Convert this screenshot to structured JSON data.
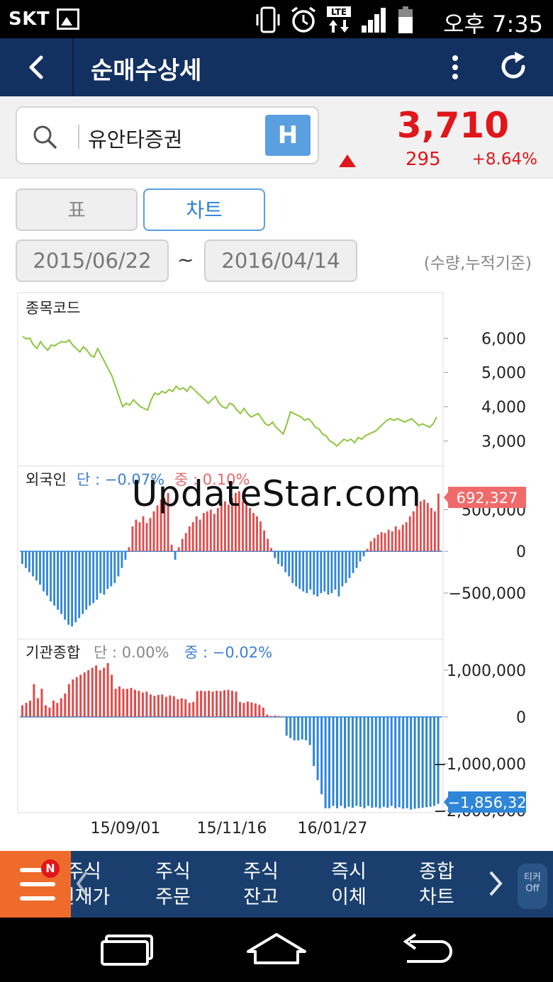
{
  "status_bar": {
    "carrier": "SKT",
    "network": "LTE",
    "time": "오후 7:35"
  },
  "header": {
    "title": "순매수상세"
  },
  "search": {
    "value": "유안타증권",
    "h_button": "H"
  },
  "quote": {
    "price": "3,710",
    "change": "295",
    "change_pct": "+8.64%",
    "direction": "up",
    "up_color": "#e0161a"
  },
  "tabs": {
    "table": "표",
    "chart": "차트",
    "active": "chart"
  },
  "date_range": {
    "from": "2015/06/22",
    "separator": "~",
    "to": "2016/04/14",
    "basis_note": "(수량,누적기준)"
  },
  "chart_data": [
    {
      "type": "line",
      "title": "종목코드",
      "x_ticks": [
        "15/09/01",
        "15/11/16",
        "16/01/27"
      ],
      "y_ticks": [
        "6,000",
        "5,000",
        "4,000",
        "3,000"
      ],
      "ylim": [
        2800,
        6400
      ],
      "color": "#8dc63f",
      "values": [
        6050,
        5980,
        6000,
        5800,
        5700,
        5900,
        5750,
        5650,
        5800,
        5780,
        5850,
        5900,
        5880,
        5950,
        5800,
        5700,
        5600,
        5750,
        5650,
        5500,
        5450,
        5700,
        5500,
        5300,
        5100,
        4900,
        4600,
        4300,
        4000,
        4100,
        4050,
        4200,
        4100,
        4000,
        3950,
        3900,
        4200,
        4400,
        4350,
        4450,
        4400,
        4500,
        4450,
        4600,
        4500,
        4550,
        4450,
        4600,
        4500,
        4400,
        4300,
        4200,
        4100,
        4200,
        4300,
        4100,
        4000,
        3950,
        4100,
        4050,
        3900,
        3800,
        3950,
        3800,
        3700,
        3750,
        3800,
        3650,
        3500,
        3450,
        3550,
        3400,
        3300,
        3200,
        3500,
        3850,
        3800,
        3750,
        3700,
        3600,
        3650,
        3550,
        3400,
        3350,
        3200,
        3150,
        3000,
        2950,
        2850,
        2950,
        3050,
        3000,
        3050,
        2950,
        3100,
        3050,
        3150,
        3200,
        3250,
        3300,
        3400,
        3500,
        3600,
        3650,
        3600,
        3650,
        3600,
        3550,
        3600,
        3650,
        3550,
        3450,
        3500,
        3450,
        3400,
        3500,
        3700
      ]
    },
    {
      "type": "bar",
      "title": "외국인",
      "annotations": [
        {
          "label": "단 : −0.07%",
          "color": "#3d7fd1"
        },
        {
          "label": "중 : 0.10%",
          "color": "#e36b6b"
        }
      ],
      "y_ticks": [
        "500,000",
        "0",
        "−500,000"
      ],
      "last_value_label": "692,327",
      "ylim": [
        -950000,
        800000
      ],
      "pos_color": "#e24a4a",
      "neg_color": "#2e86d8",
      "values": [
        -150000,
        -200000,
        -250000,
        -300000,
        -350000,
        -400000,
        -480000,
        -530000,
        -600000,
        -650000,
        -700000,
        -750000,
        -820000,
        -880000,
        -900000,
        -850000,
        -800000,
        -750000,
        -700000,
        -650000,
        -620000,
        -580000,
        -500000,
        -520000,
        -450000,
        -420000,
        -380000,
        -300000,
        -200000,
        -100000,
        50000,
        300000,
        380000,
        350000,
        420000,
        340000,
        400000,
        480000,
        550000,
        620000,
        640000,
        700000,
        80000,
        -100000,
        50000,
        150000,
        220000,
        300000,
        350000,
        420000,
        380000,
        460000,
        480000,
        500000,
        450000,
        520000,
        580000,
        600000,
        560000,
        640000,
        700000,
        720000,
        600000,
        560000,
        520000,
        460000,
        420000,
        360000,
        250000,
        150000,
        40000,
        -80000,
        -150000,
        -180000,
        -250000,
        -300000,
        -380000,
        -420000,
        -450000,
        -480000,
        -500000,
        -460000,
        -520000,
        -540000,
        -500000,
        -480000,
        -520000,
        -500000,
        -460000,
        -540000,
        -420000,
        -380000,
        -320000,
        -260000,
        -200000,
        -120000,
        -60000,
        30000,
        120000,
        160000,
        200000,
        230000,
        220000,
        260000,
        240000,
        300000,
        260000,
        320000,
        350000,
        420000,
        480000,
        560000,
        600000,
        620000,
        580000,
        520000,
        480000,
        692327
      ]
    },
    {
      "type": "bar",
      "title": "기관종합",
      "annotations": [
        {
          "label": "단 : 0.00%",
          "color": "#888888"
        },
        {
          "label": "중 : −0.02%",
          "color": "#3d7fd1"
        }
      ],
      "y_ticks": [
        "1,000,000",
        "0",
        "−1,000,000",
        "−2,000,000"
      ],
      "last_value_label": "−1,856,32",
      "ylim": [
        -2000000,
        1300000
      ],
      "pos_color": "#e24a4a",
      "neg_color": "#2e86d8",
      "values": [
        250000,
        300000,
        350000,
        700000,
        400000,
        600000,
        250000,
        200000,
        350000,
        300000,
        400000,
        500000,
        700000,
        800000,
        850000,
        900000,
        950000,
        1000000,
        1050000,
        1100000,
        1000000,
        1050000,
        1150000,
        900000,
        600000,
        650000,
        600000,
        600000,
        620000,
        580000,
        560000,
        520000,
        540000,
        480000,
        450000,
        470000,
        480000,
        430000,
        460000,
        440000,
        380000,
        400000,
        380000,
        300000,
        320000,
        550000,
        560000,
        550000,
        560000,
        540000,
        560000,
        550000,
        570000,
        580000,
        560000,
        540000,
        320000,
        300000,
        330000,
        310000,
        290000,
        260000,
        200000,
        50000,
        20000,
        30000,
        20000,
        10000,
        -400000,
        -450000,
        -500000,
        -500000,
        -480000,
        -500000,
        -600000,
        -1050000,
        -1350000,
        -1650000,
        -1950000,
        -1950000,
        -1900000,
        -1950000,
        -1900000,
        -1950000,
        -1920000,
        -1940000,
        -1900000,
        -1920000,
        -1950000,
        -1900000,
        -1940000,
        -1930000,
        -1950000,
        -1920000,
        -1940000,
        -1900000,
        -1950000,
        -1930000,
        -1960000,
        -1950000,
        -1980000,
        -1960000,
        -1950000,
        -1940000,
        -1930000,
        -1920000,
        -1900000,
        -1856320
      ]
    }
  ],
  "bottom_nav": {
    "badge": "N",
    "items": [
      {
        "line1": "주식",
        "line2": "현재가"
      },
      {
        "line1": "주식",
        "line2": "주문"
      },
      {
        "line1": "주식",
        "line2": "잔고"
      },
      {
        "line1": "즉시",
        "line2": "이체"
      },
      {
        "line1": "종합",
        "line2": "차트"
      }
    ],
    "ticker_line1": "티커",
    "ticker_line2": "Off"
  },
  "watermark": "UpdateStar.com"
}
